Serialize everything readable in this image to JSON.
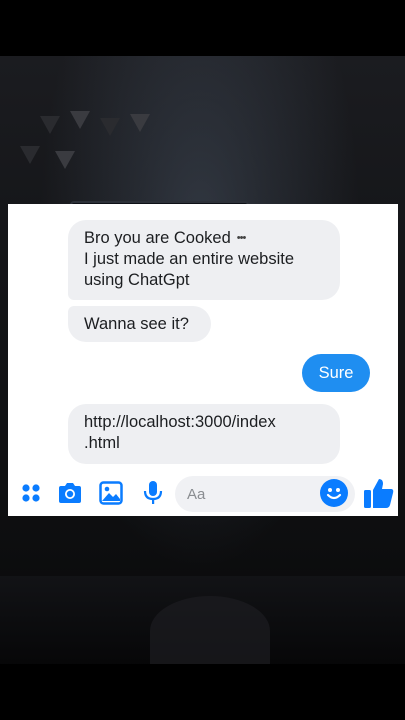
{
  "conversation": {
    "messages": [
      {
        "sender": "other",
        "lines": [
          "Bro you are Cooked",
          "I just made an entire website",
          "using ChatGpt"
        ],
        "emoji": "skull-emoji"
      },
      {
        "sender": "other",
        "lines": [
          "Wanna see it?"
        ]
      },
      {
        "sender": "me",
        "text": "Sure"
      },
      {
        "sender": "other",
        "lines": [
          "http://localhost:3000/index",
          ".html"
        ]
      }
    ]
  },
  "composer": {
    "placeholder": "Aa",
    "icons": [
      "apps-grid-icon",
      "camera-icon",
      "image-icon",
      "microphone-icon",
      "emoji-icon",
      "thumbs-up-icon"
    ]
  },
  "colors": {
    "accent": "#1f8ef1",
    "icon": "#0a7cff",
    "received_bubble": "#eeeff2",
    "text": "#1c1e21"
  }
}
